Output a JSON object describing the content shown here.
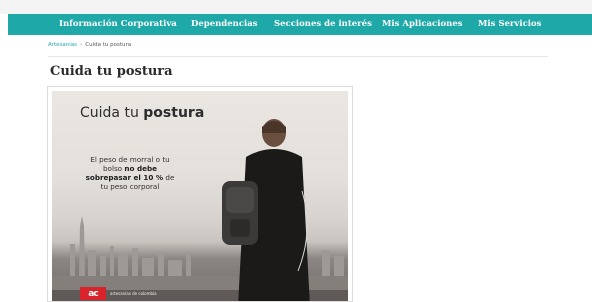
{
  "nav": {
    "items": [
      {
        "label": "Información Corporativa"
      },
      {
        "label": "Dependencias"
      },
      {
        "label": "Secciones de interés"
      },
      {
        "label": "Mis Aplicaciones"
      },
      {
        "label": "Mis Servicios"
      }
    ]
  },
  "breadcrumb": {
    "home": "Artesanías",
    "separator": "›",
    "current": "Cuida tu postura"
  },
  "page": {
    "title": "Cuida tu postura"
  },
  "poster": {
    "heading_light": "Cuida tu",
    "heading_bold": "postura",
    "line1": "El peso de morral o tu",
    "line2_pre": "bolso",
    "line2_bold": "no debe",
    "line3_bold": "sobrepasar el 10 %",
    "line3_post": "de",
    "line4": "tu peso corporal",
    "brand_mark": "ac",
    "brand_text": "artesanías de colombia"
  },
  "colors": {
    "nav_bg": "#1fa8a8",
    "brand_red": "#d8232a"
  }
}
